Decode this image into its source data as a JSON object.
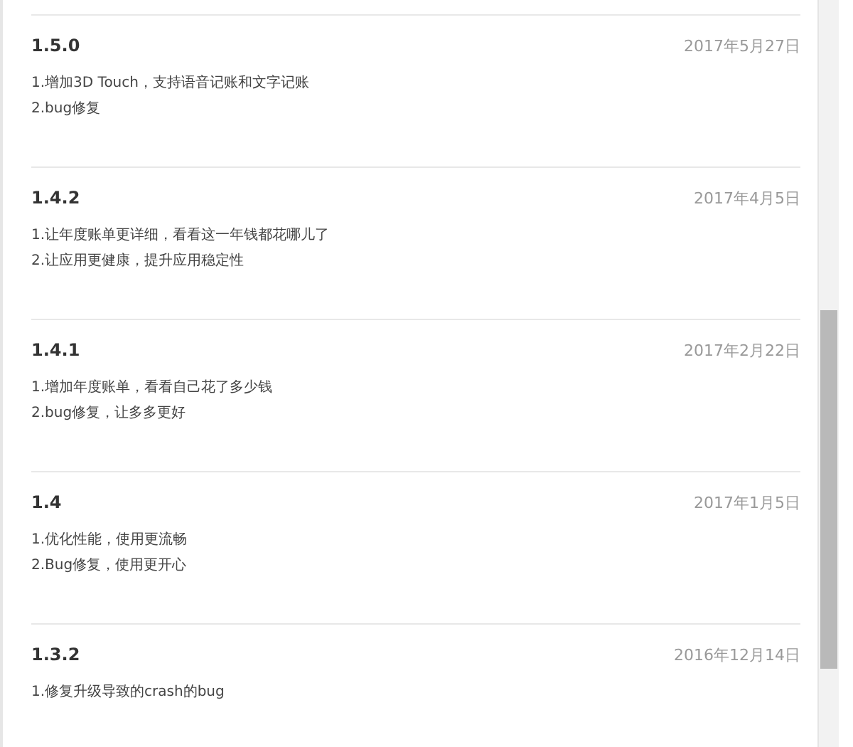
{
  "releases": [
    {
      "version": "1.5.0",
      "date": "2017年5月27日",
      "notes": [
        "1.增加3D Touch，支持语音记账和文字记账",
        "2.bug修复"
      ]
    },
    {
      "version": "1.4.2",
      "date": "2017年4月5日",
      "notes": [
        "1.让年度账单更详细，看看这一年钱都花哪儿了",
        "2.让应用更健康，提升应用稳定性"
      ]
    },
    {
      "version": "1.4.1",
      "date": "2017年2月22日",
      "notes": [
        "1.增加年度账单，看看自己花了多少钱",
        "2.bug修复，让多多更好"
      ]
    },
    {
      "version": "1.4",
      "date": "2017年1月5日",
      "notes": [
        "1.优化性能，使用更流畅",
        "2.Bug修复，使用更开心"
      ]
    },
    {
      "version": "1.3.2",
      "date": "2016年12月14日",
      "notes": [
        "1.修复升级导致的crash的bug"
      ]
    }
  ]
}
